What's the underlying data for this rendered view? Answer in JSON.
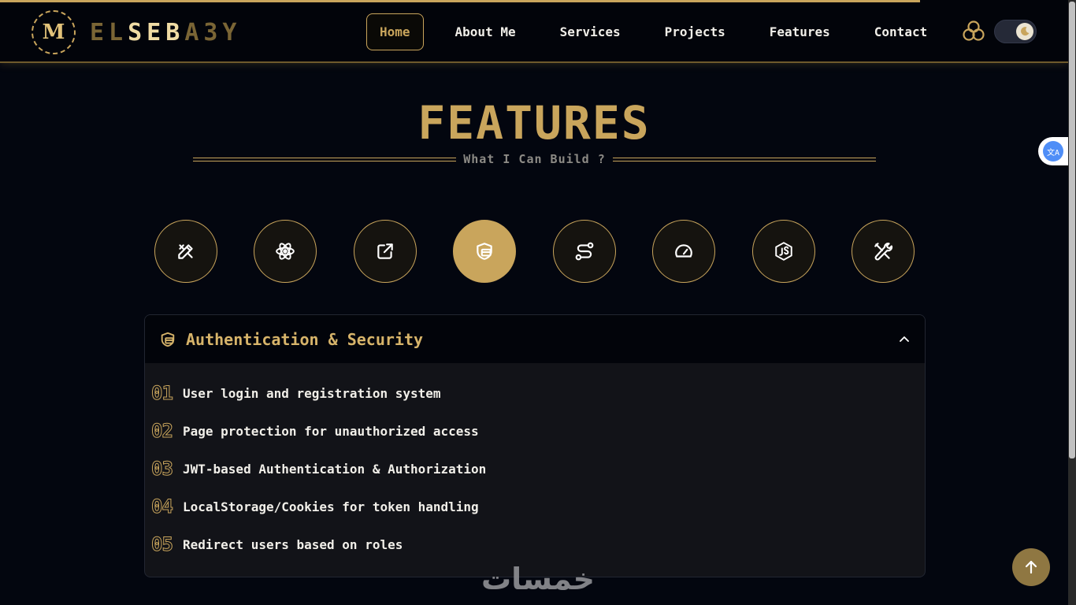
{
  "header": {
    "logo_initial": "M",
    "logo_ring_text": "MAHMOUD ELSEBAEY • SOFTWARE ENGINEER",
    "brand_prefix": "EL",
    "brand_highlight": "SEB",
    "brand_suffix": "A3Y"
  },
  "nav": {
    "items": [
      {
        "label": "Home"
      },
      {
        "label": "About Me"
      },
      {
        "label": "Services"
      },
      {
        "label": "Projects"
      },
      {
        "label": "Features"
      },
      {
        "label": "Contact"
      }
    ],
    "active": "Home"
  },
  "translate": {
    "label": "文A"
  },
  "section": {
    "title": "FEATURES",
    "subtitle": "What I Can Build ?"
  },
  "feature_icons": [
    {
      "icon": "design-tools-icon"
    },
    {
      "icon": "react-icon"
    },
    {
      "icon": "external-link-icon"
    },
    {
      "icon": "shield-icon",
      "active": true
    },
    {
      "icon": "route-icon"
    },
    {
      "icon": "speedometer-icon"
    },
    {
      "icon": "nodejs-icon"
    },
    {
      "icon": "tools-icon"
    }
  ],
  "accordion": {
    "title": "Authentication & Security",
    "items": [
      {
        "num": "01",
        "text": "User login and registration system"
      },
      {
        "num": "02",
        "text": "Page protection for unauthorized access"
      },
      {
        "num": "03",
        "text": "JWT-based Authentication & Authorization"
      },
      {
        "num": "04",
        "text": "LocalStorage/Cookies for token handling"
      },
      {
        "num": "05",
        "text": "Redirect users based on roles"
      }
    ]
  },
  "watermark": "خمسات",
  "colors": {
    "accent": "#c9a55c",
    "background": "#03060f",
    "panel": "#121318"
  }
}
